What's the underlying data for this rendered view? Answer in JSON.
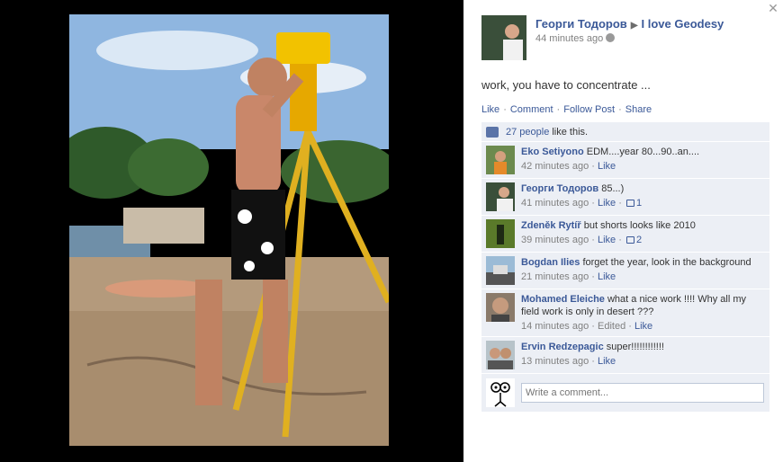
{
  "post": {
    "author": "Георги Тодоров",
    "group": "I love Geodesy",
    "time": "44 minutes ago",
    "message": "work, you have to concentrate ..."
  },
  "actions": {
    "like": "Like",
    "comment": "Comment",
    "follow": "Follow Post",
    "share": "Share",
    "separator": "·"
  },
  "likes": {
    "count_link": "27 people",
    "suffix": "like this."
  },
  "comments": [
    {
      "author": "Eko Setiyono",
      "text": "EDM....year 80...90..an....",
      "time": "42 minutes ago",
      "like": "Like",
      "likes": ""
    },
    {
      "author": "Георги Тодоров",
      "text": "85...)",
      "time": "41 minutes ago",
      "like": "Like",
      "likes": "1"
    },
    {
      "author": "Zdeněk Rytíř",
      "text": "but shorts looks like 2010",
      "time": "39 minutes ago",
      "like": "Like",
      "likes": "2"
    },
    {
      "author": "Bogdan Ilies",
      "text": "forget the year, look in the background",
      "time": "21 minutes ago",
      "like": "Like",
      "likes": ""
    },
    {
      "author": "Mohamed Eleiche",
      "text": "what a nice work !!!! Why all my field work is only in desert ???",
      "time": "14 minutes ago",
      "edited": "Edited",
      "like": "Like",
      "likes": ""
    },
    {
      "author": "Ervin Redzepagic",
      "text": "super!!!!!!!!!!!!",
      "time": "13 minutes ago",
      "like": "Like",
      "likes": ""
    }
  ],
  "composer": {
    "placeholder": "Write a comment..."
  },
  "icons": {
    "close": "close-icon",
    "arrow": "triangle-right-icon",
    "globe": "globe-icon",
    "like": "thumbs-up-icon"
  },
  "colors": {
    "link": "#3b5998",
    "ufi_bg": "#eceff5",
    "stage_bg": "#000000"
  }
}
